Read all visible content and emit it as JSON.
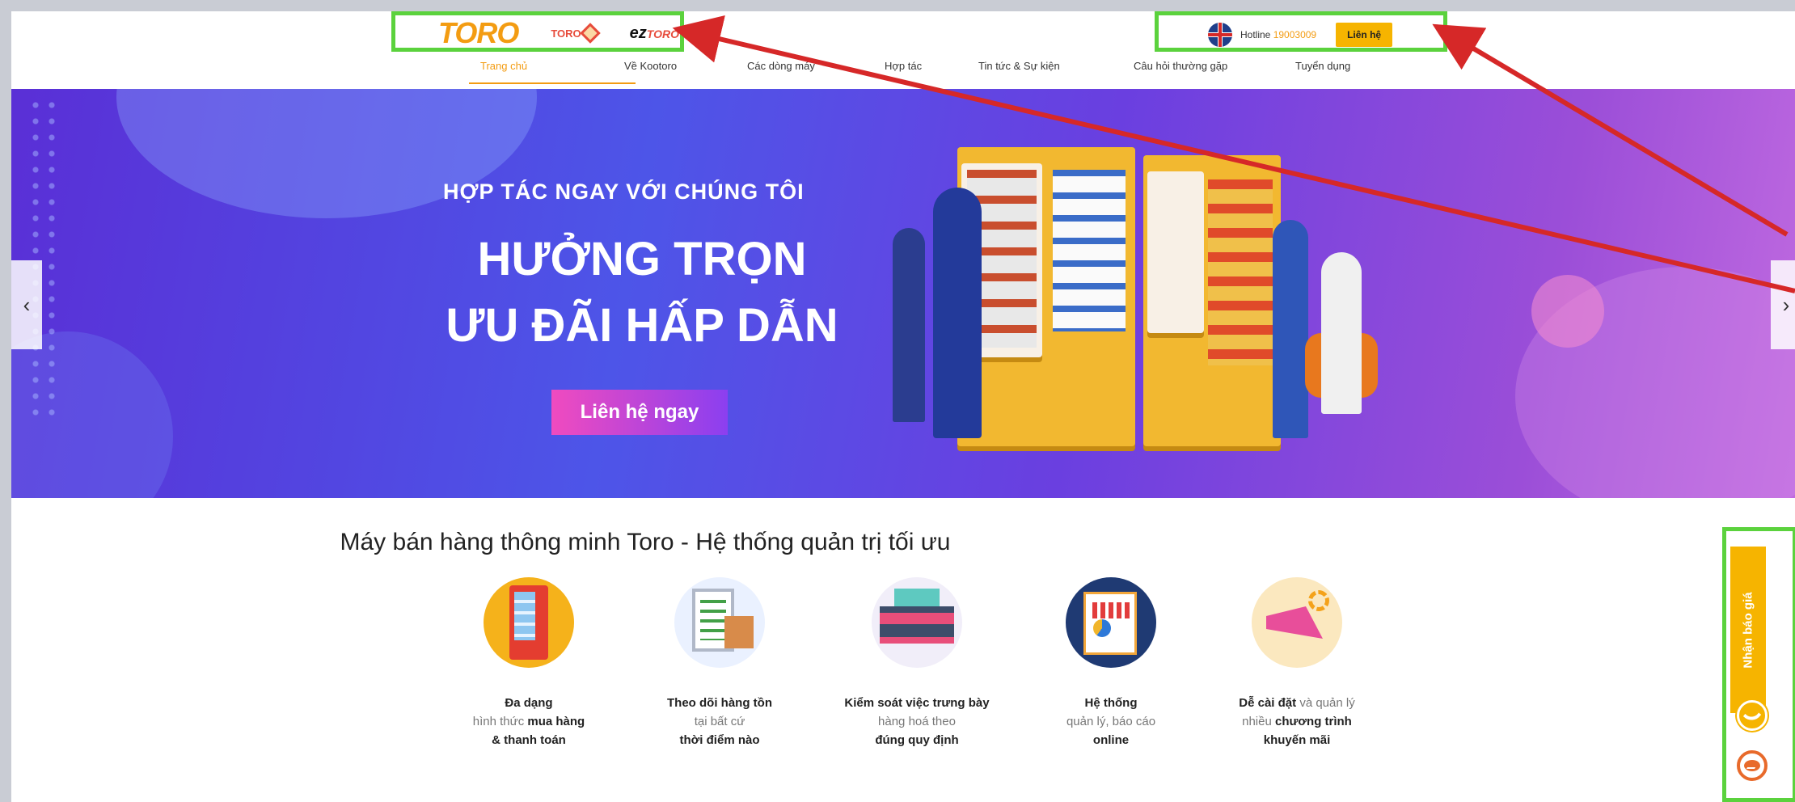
{
  "header": {
    "logos": [
      {
        "name": "TORO"
      },
      {
        "name": "TORO"
      },
      {
        "name": "ez",
        "suffix": "TORO"
      }
    ],
    "hotline_label": "Hotline",
    "hotline_number": "19003009",
    "contact_button": "Liên hệ",
    "language_icon": "uk-flag-icon"
  },
  "nav": {
    "items": [
      {
        "label": "Trang chủ",
        "active": true
      },
      {
        "label": "Về Kootoro"
      },
      {
        "label": "Các dòng máy"
      },
      {
        "label": "Hợp tác"
      },
      {
        "label": "Tin tức & Sự kiện"
      },
      {
        "label": "Câu hỏi thường gặp"
      },
      {
        "label": "Tuyển dụng"
      }
    ]
  },
  "banner": {
    "kicker": "HỢP TÁC NGAY VỚI CHÚNG TÔI",
    "title_line1": "HƯỞNG TRỌN",
    "title_line2": "ƯU ĐÃI HẤP DẪN",
    "cta": "Liên hệ ngay",
    "prev_arrow": "‹",
    "next_arrow": "›"
  },
  "section": {
    "title": "Máy bán hàng thông minh Toro - Hệ thống quản trị tối ưu"
  },
  "features": [
    {
      "icon": "vending-machine-icon",
      "l1": "Đa dạng",
      "l2a": "hình thức ",
      "l2b": "mua hàng",
      "l3": "& thanh toán"
    },
    {
      "icon": "clipboard-inventory-icon",
      "l1": "Theo dõi hàng tồn",
      "l2": "tại bất cứ",
      "l3": "thời điểm nào"
    },
    {
      "icon": "shelf-display-icon",
      "l1": "Kiểm soát việc trưng bày",
      "l2": "hàng hoá theo",
      "l3": "đúng quy định"
    },
    {
      "icon": "report-chart-icon",
      "l1": "Hệ thống",
      "l2": "quản lý, báo cáo",
      "l3": "online"
    },
    {
      "icon": "megaphone-gear-icon",
      "l1a": "Dễ cài đặt",
      "l1b": " và quản lý",
      "l2a": "nhiều ",
      "l2b": "chương trình",
      "l3": "khuyến mãi"
    }
  ],
  "side_widget": {
    "quote_label": "Nhận báo giá",
    "phone_icon": "phone-icon",
    "messenger_icon": "messenger-icon"
  },
  "annotation_colors": {
    "box": "#5bd23d",
    "arrow": "#d62828"
  }
}
